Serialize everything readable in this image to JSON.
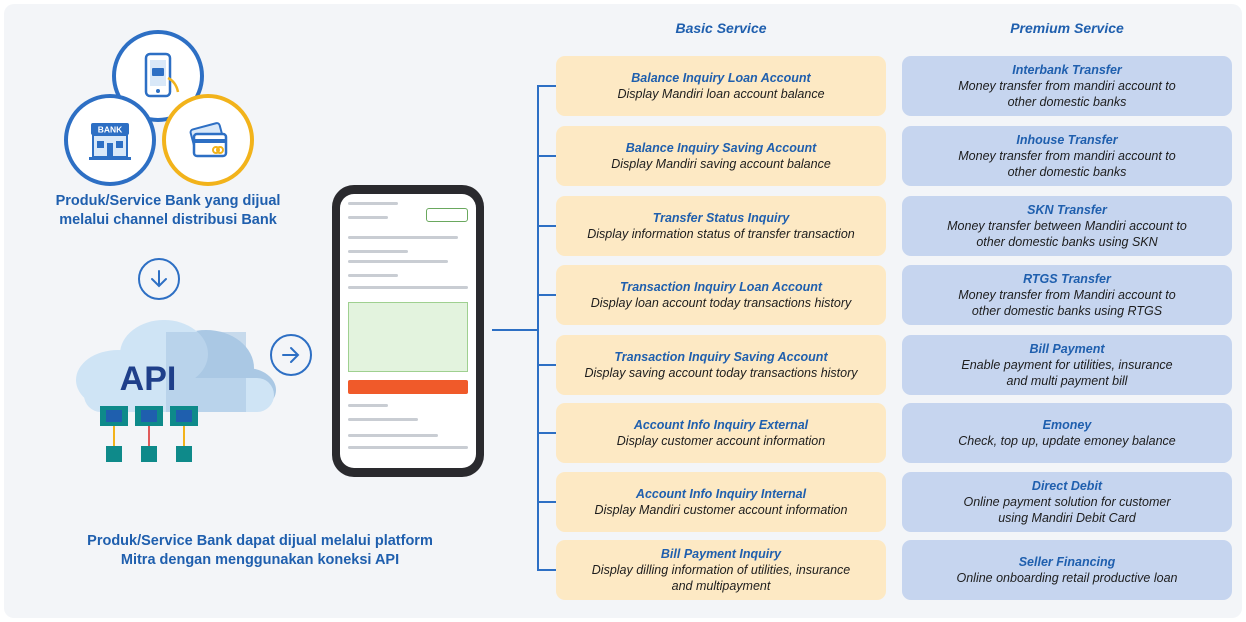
{
  "left": {
    "bank_label": "BANK",
    "api_label": "API",
    "caption_top": "Produk/Service Bank yang dijual\nmelalui channel distribusi Bank",
    "caption_bottom": "Produk/Service Bank dapat dijual melalui platform\nMitra dengan menggunakan koneksi API"
  },
  "headers": {
    "basic": "Basic Service",
    "premium": "Premium Service"
  },
  "basic_services": [
    {
      "title": "Balance Inquiry Loan Account",
      "desc": "Display Mandiri loan account balance"
    },
    {
      "title": "Balance Inquiry Saving Account",
      "desc": "Display Mandiri saving account balance"
    },
    {
      "title": "Transfer Status Inquiry",
      "desc": "Display information status of transfer transaction"
    },
    {
      "title": "Transaction Inquiry Loan Account",
      "desc": "Display loan account today transactions history"
    },
    {
      "title": "Transaction Inquiry Saving Account",
      "desc": "Display saving account today transactions history"
    },
    {
      "title": "Account Info Inquiry External",
      "desc": "Display customer account information"
    },
    {
      "title": "Account Info Inquiry Internal",
      "desc": "Display Mandiri customer account information"
    },
    {
      "title": "Bill Payment Inquiry",
      "desc": "Display dilling information of utilities, insurance\nand multipayment"
    }
  ],
  "premium_services": [
    {
      "title": "Interbank Transfer",
      "desc": "Money transfer from mandiri account to\nother domestic banks"
    },
    {
      "title": "Inhouse Transfer",
      "desc": "Money transfer from mandiri account to\nother domestic banks"
    },
    {
      "title": "SKN Transfer",
      "desc": "Money transfer between Mandiri account to\nother domestic banks using SKN"
    },
    {
      "title": "RTGS Transfer",
      "desc": "Money transfer from Mandiri account to\nother domestic banks using RTGS"
    },
    {
      "title": "Bill Payment",
      "desc": "Enable payment for utilities, insurance\nand multi payment bill"
    },
    {
      "title": "Emoney",
      "desc": "Check, top up, update emoney balance"
    },
    {
      "title": "Direct Debit",
      "desc": "Online payment solution for customer\nusing Mandiri Debit Card"
    },
    {
      "title": "Seller Financing",
      "desc": "Online onboarding retail productive loan"
    }
  ],
  "colors": {
    "accent": "#1f5fae",
    "basic_bg": "#fde9c4",
    "premium_bg": "#c6d5ef",
    "panel_bg": "#f3f5f8"
  }
}
